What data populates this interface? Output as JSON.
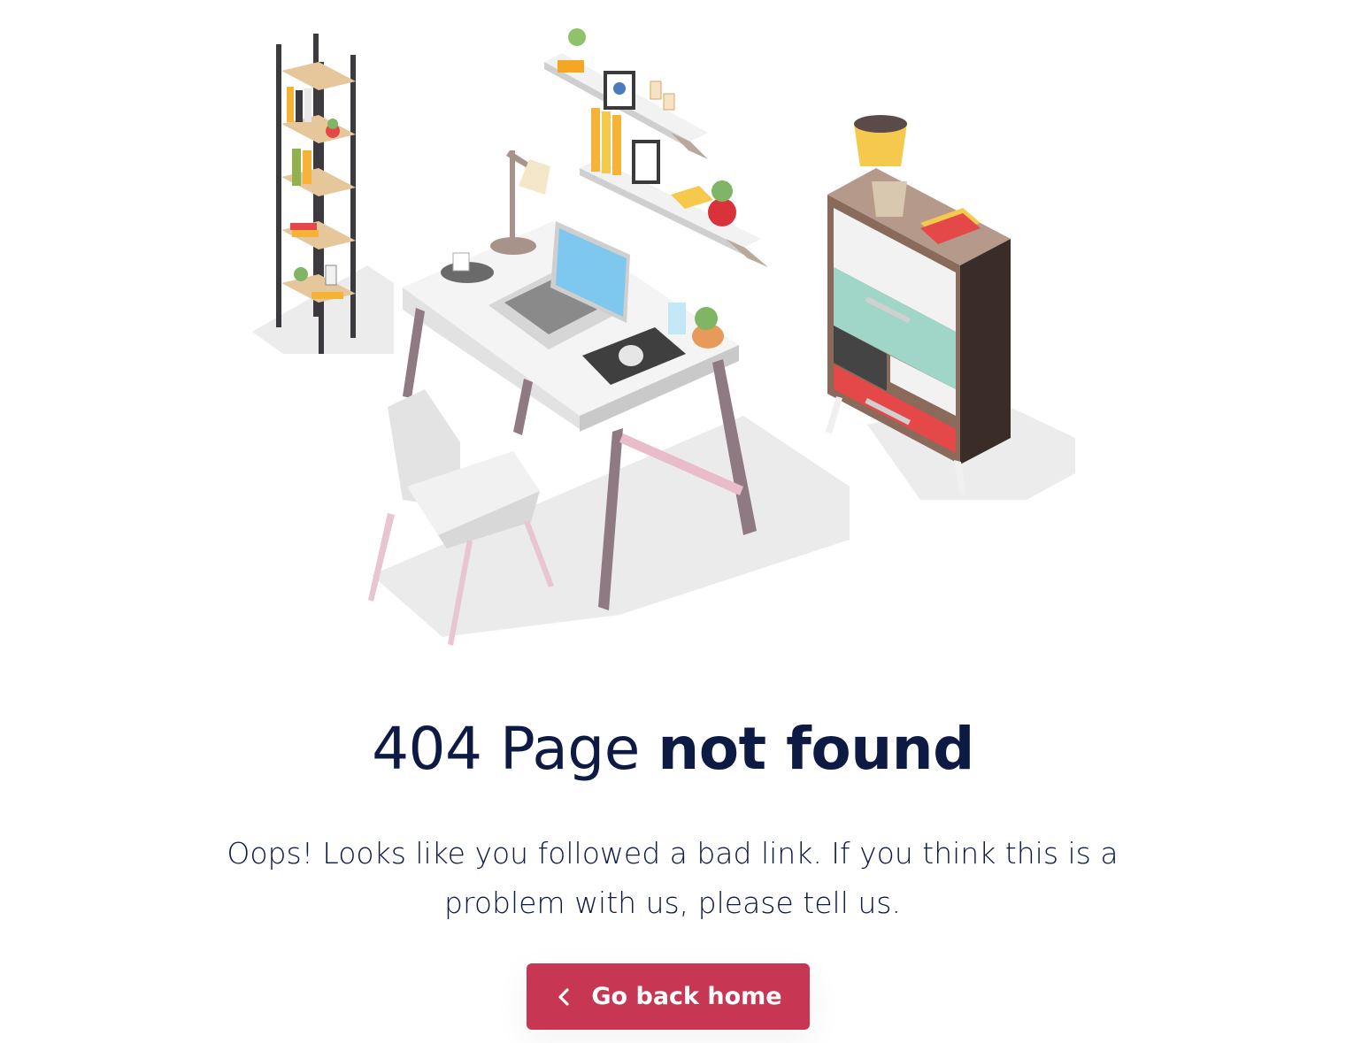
{
  "title": {
    "prefix": "404 Page ",
    "emphasis": "not found"
  },
  "message": "Oops! Looks like you followed a bad link. If you think this is a problem with us, please tell us.",
  "button": {
    "label": "Go back home",
    "icon": "chevron-left-icon"
  },
  "colors": {
    "text": "#0d1a44",
    "accent": "#c73652",
    "background": "#ffffff"
  },
  "illustration": {
    "subject": "isometric home office"
  }
}
